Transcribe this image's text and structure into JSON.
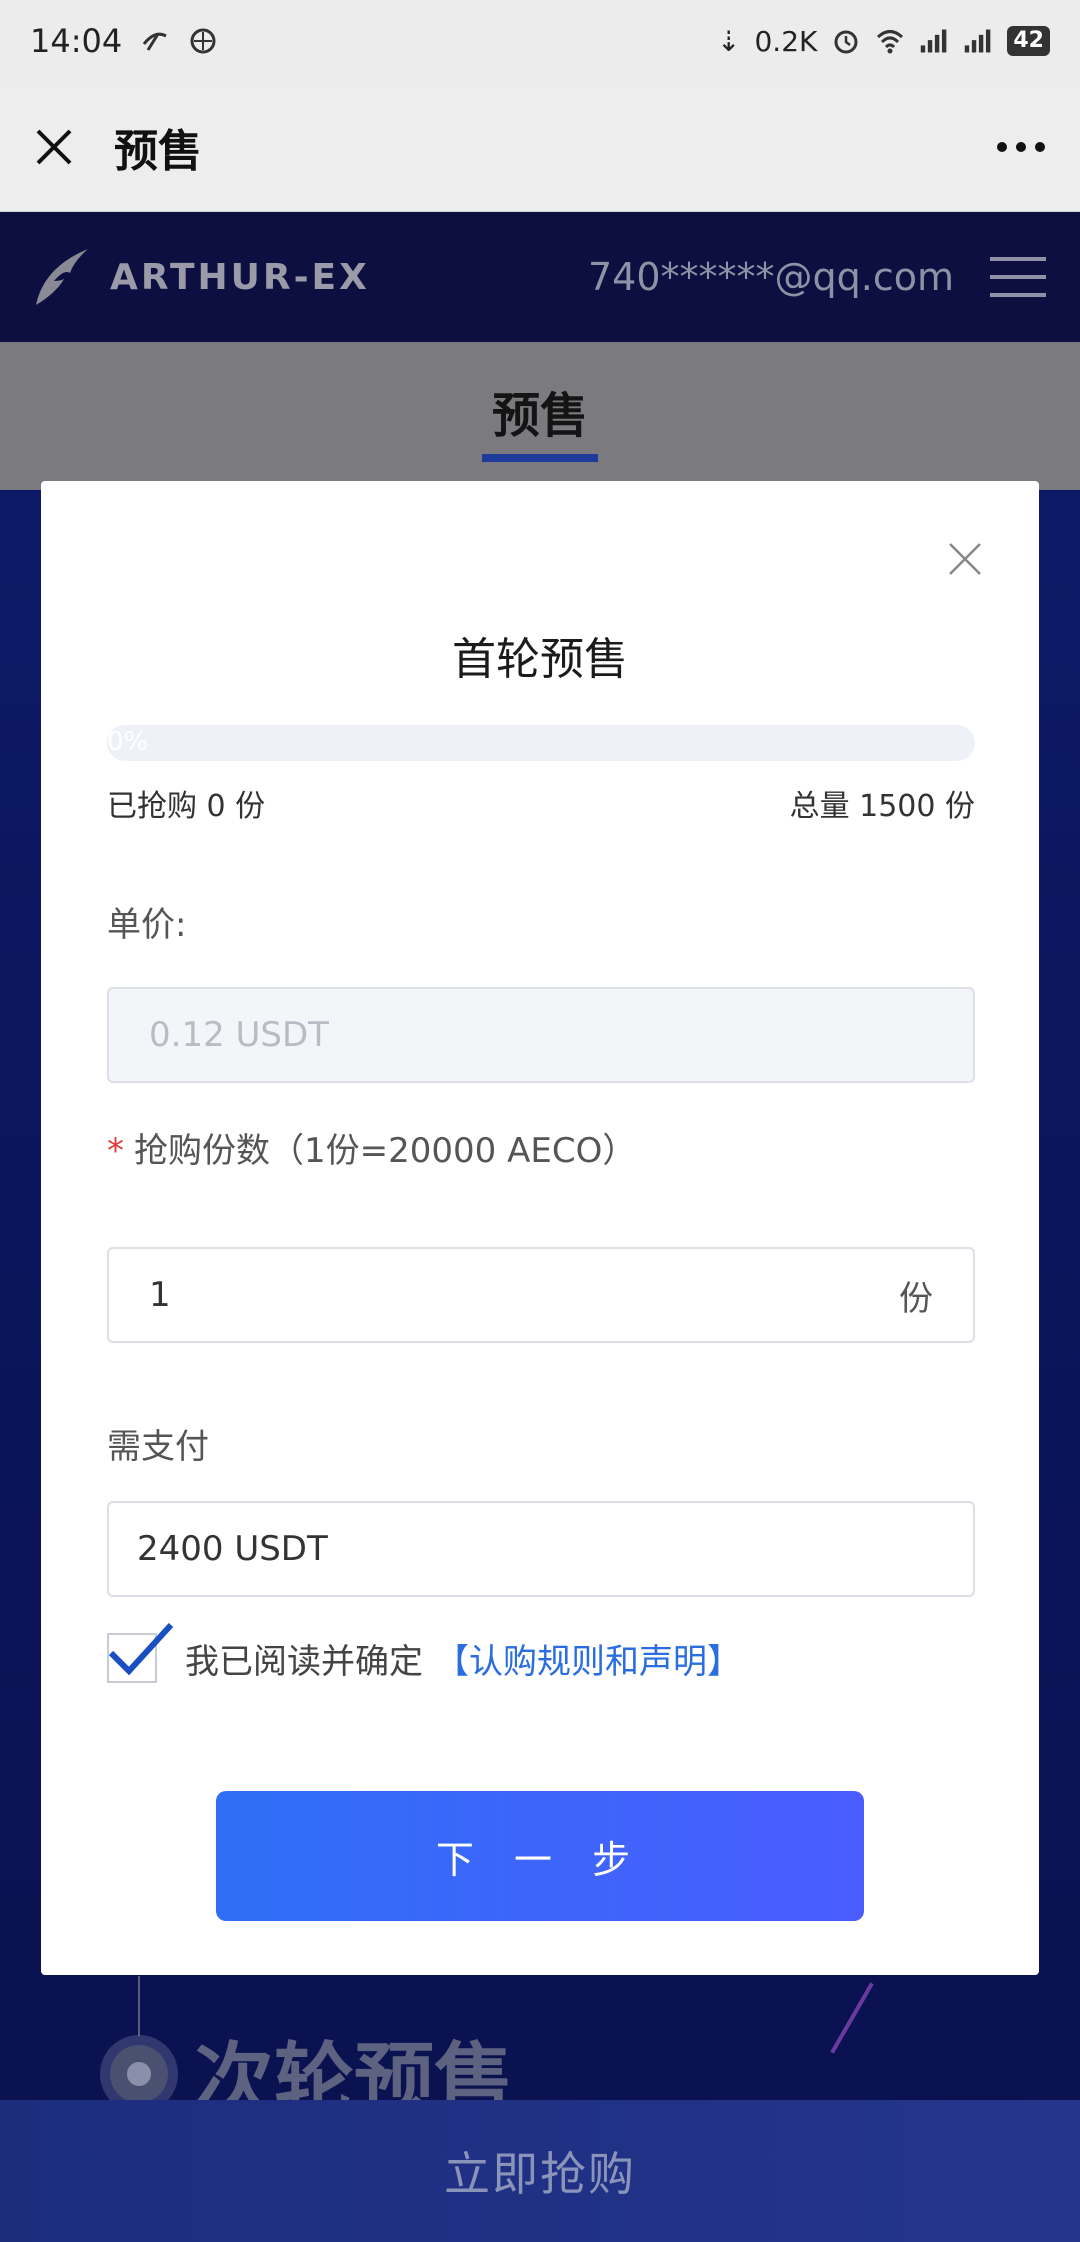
{
  "status_bar": {
    "time": "14:04",
    "net_speed": "0.2K",
    "battery": "42"
  },
  "titlebar": {
    "title": "预售"
  },
  "site_header": {
    "logo_text": "ARTHUR-EX",
    "email": "740******@qq.com"
  },
  "tabs": {
    "active": "预售"
  },
  "modal": {
    "title": "首轮预售",
    "progress_text": "0%",
    "progress": 0,
    "bought": "已抢购 0 份",
    "total": "总量 1500 份",
    "price_label": "单价:",
    "price_value": "0.12 USDT",
    "qty_required": "*",
    "qty_label": "抢购份数（1份=20000 AECO）",
    "qty_value": "1",
    "qty_unit": "份",
    "pay_label": "需支付",
    "pay_value": "2400 USDT",
    "agree_text": "我已阅读并确定",
    "agree_link": "【认购规则和声明】",
    "agree_checked": true,
    "next_button": "下 一 步"
  },
  "background": {
    "next_round": "次轮预售",
    "buy_button": "立即抢购"
  },
  "colors": {
    "primary": "#3a6cf5",
    "link": "#2a6de0",
    "required": "#e03b3b"
  }
}
